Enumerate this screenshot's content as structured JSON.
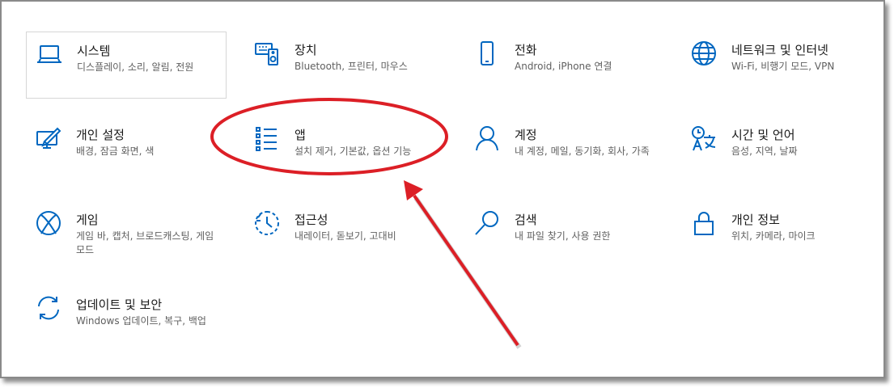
{
  "accent_color": "#0067c0",
  "annotation_color": "#dc1f26",
  "tiles": [
    {
      "title": "시스템",
      "desc": "디스플레이, 소리, 알림, 전원",
      "icon": "laptop-icon"
    },
    {
      "title": "장치",
      "desc": "Bluetooth, 프린터, 마우스",
      "icon": "devices-icon"
    },
    {
      "title": "전화",
      "desc": "Android, iPhone 연결",
      "icon": "phone-icon"
    },
    {
      "title": "네트워크 및 인터넷",
      "desc": "Wi-Fi, 비행기 모드, VPN",
      "icon": "globe-icon"
    },
    {
      "title": "개인 설정",
      "desc": "배경, 잠금 화면, 색",
      "icon": "personalize-icon"
    },
    {
      "title": "앱",
      "desc": "설치 제거, 기본값, 옵션 기능",
      "icon": "apps-list-icon"
    },
    {
      "title": "계정",
      "desc": "내 계정, 메일, 동기화, 회사, 가족",
      "icon": "person-icon"
    },
    {
      "title": "시간 및 언어",
      "desc": "음성, 지역, 날짜",
      "icon": "time-language-icon"
    },
    {
      "title": "게임",
      "desc": "게임 바, 캡처, 브로드캐스팅, 게임 모드",
      "icon": "xbox-icon"
    },
    {
      "title": "접근성",
      "desc": "내레이터, 돋보기, 고대비",
      "icon": "ease-of-access-icon"
    },
    {
      "title": "검색",
      "desc": "내 파일 찾기, 사용 권한",
      "icon": "search-icon"
    },
    {
      "title": "개인 정보",
      "desc": "위치, 카메라, 마이크",
      "icon": "lock-icon"
    },
    {
      "title": "업데이트 및 보안",
      "desc": "Windows 업데이트, 복구, 백업",
      "icon": "sync-icon"
    }
  ]
}
